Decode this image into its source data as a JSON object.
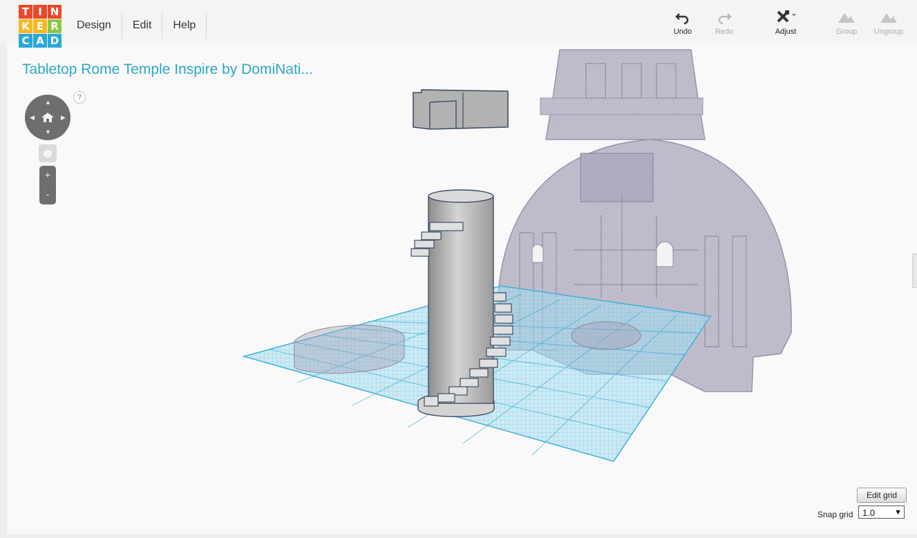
{
  "logo": {
    "letters": [
      "T",
      "I",
      "N",
      "K",
      "E",
      "R",
      "C",
      "A",
      "D"
    ],
    "colors": [
      "#e8492a",
      "#e8492a",
      "#e8492a",
      "#f6b822",
      "#f6b822",
      "#8fc640",
      "#2aa8d8",
      "#2aa8d8",
      "#2aa8d8"
    ]
  },
  "menu": [
    "Design",
    "Edit",
    "Help"
  ],
  "toolbar": {
    "undo": "Undo",
    "redo": "Redo",
    "adjust": "Adjust",
    "group": "Group",
    "ungroup": "Ungroup"
  },
  "design_title": "Tabletop Rome Temple Inspire by DomiNati...",
  "view": {
    "help": "?",
    "zoom_in": "+",
    "zoom_out": "-"
  },
  "grid": {
    "edit_label": "Edit grid",
    "snap_label": "Snap grid",
    "snap_value": "1.0"
  },
  "colors": {
    "accent": "#29a8c7",
    "grid": "#5fc4e6",
    "ghost": "#8e8ca3",
    "solid": "#a9a9a9"
  }
}
